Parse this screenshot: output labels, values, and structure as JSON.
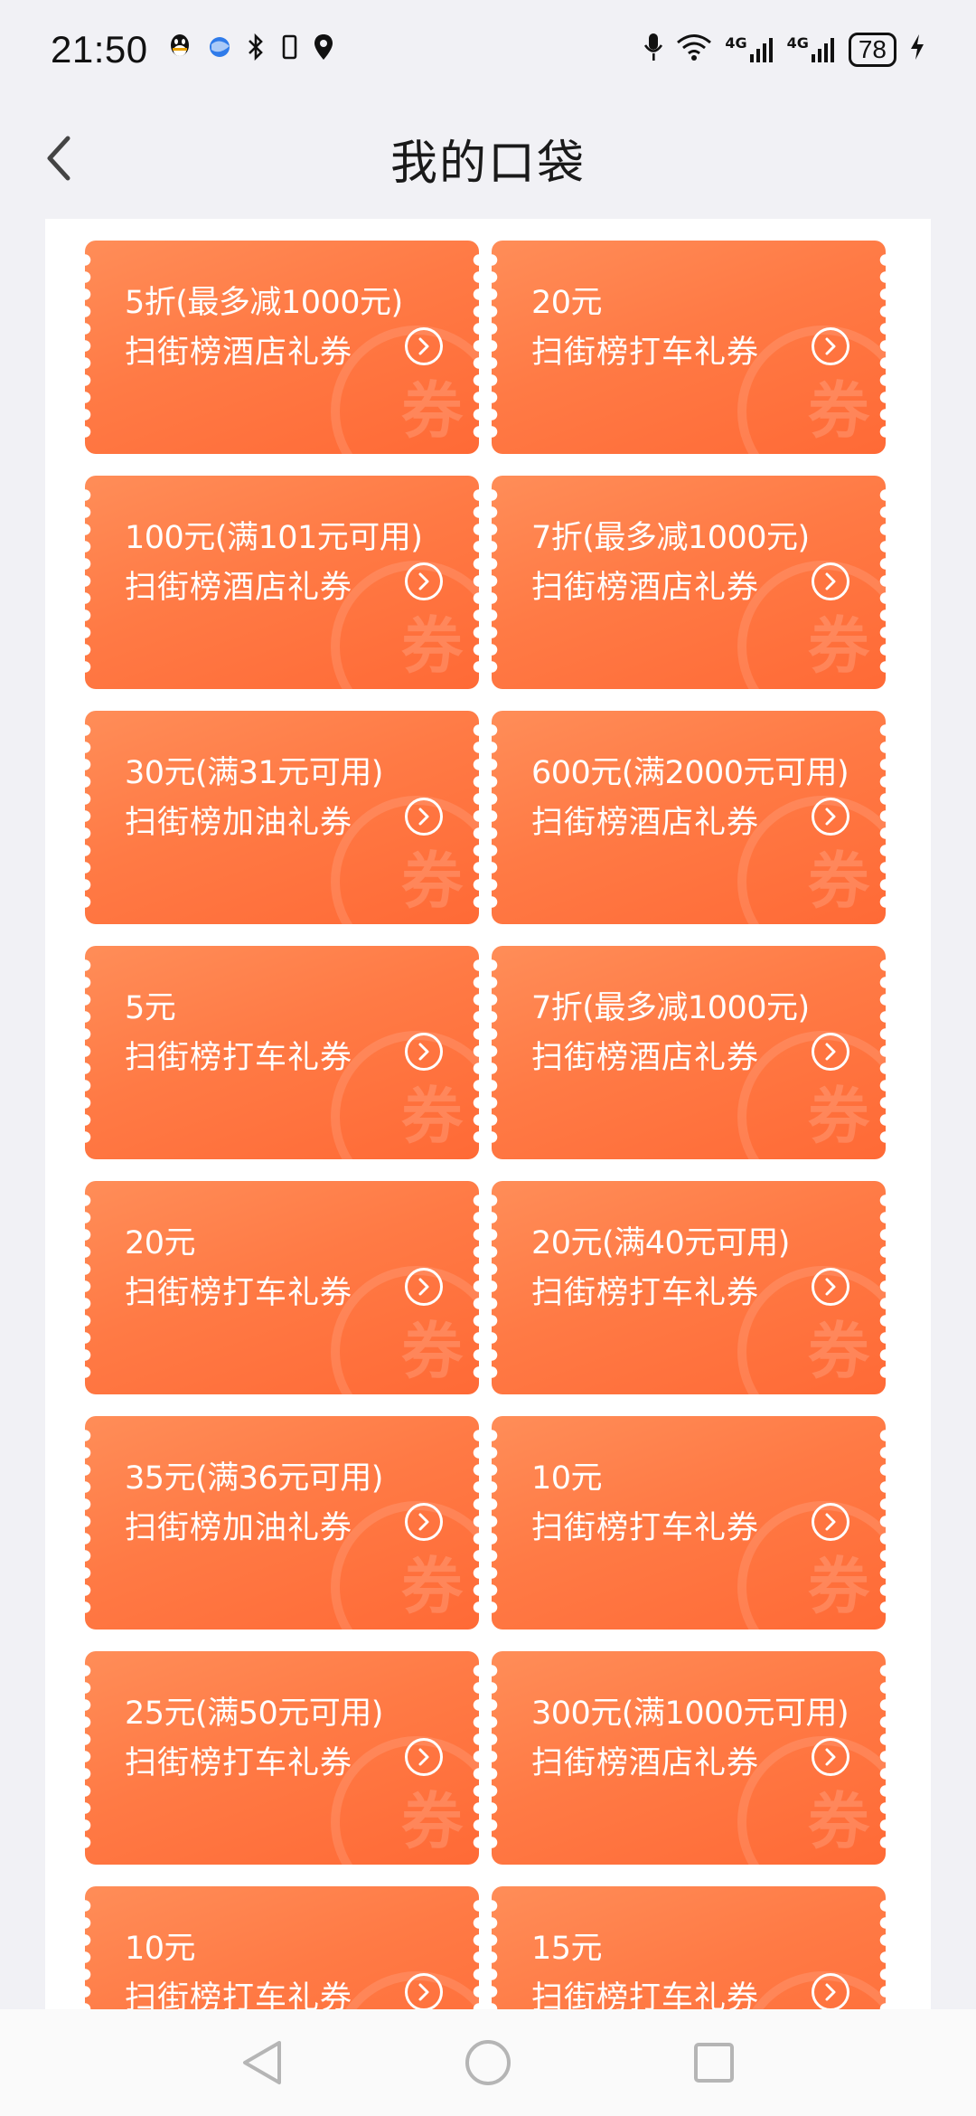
{
  "status_bar": {
    "time": "21:50",
    "battery": "78",
    "network_1": "4G",
    "network_2": "4G"
  },
  "header": {
    "title": "我的口袋"
  },
  "coupon_seal": "券",
  "coupons": [
    {
      "amount": "5折(最多减1000元)",
      "name": "扫街榜酒店礼券"
    },
    {
      "amount": "20元",
      "name": "扫街榜打车礼券"
    },
    {
      "amount": "100元(满101元可用)",
      "name": "扫街榜酒店礼券"
    },
    {
      "amount": "7折(最多减1000元)",
      "name": "扫街榜酒店礼券"
    },
    {
      "amount": "30元(满31元可用)",
      "name": "扫街榜加油礼券"
    },
    {
      "amount": "600元(满2000元可用)",
      "name": "扫街榜酒店礼券"
    },
    {
      "amount": "5元",
      "name": "扫街榜打车礼券"
    },
    {
      "amount": "7折(最多减1000元)",
      "name": "扫街榜酒店礼券"
    },
    {
      "amount": "20元",
      "name": "扫街榜打车礼券"
    },
    {
      "amount": "20元(满40元可用)",
      "name": "扫街榜打车礼券"
    },
    {
      "amount": "35元(满36元可用)",
      "name": "扫街榜加油礼券"
    },
    {
      "amount": "10元",
      "name": "扫街榜打车礼券"
    },
    {
      "amount": "25元(满50元可用)",
      "name": "扫街榜打车礼券"
    },
    {
      "amount": "300元(满1000元可用)",
      "name": "扫街榜酒店礼券"
    },
    {
      "amount": "10元",
      "name": "扫街榜打车礼券"
    },
    {
      "amount": "15元",
      "name": "扫街榜打车礼券"
    }
  ],
  "colors": {
    "coupon": "#ff7a45",
    "background": "#f1f1f5"
  },
  "icons": {
    "back": "chevron-left-icon",
    "coupon_action": "chevron-right-circle-icon"
  }
}
